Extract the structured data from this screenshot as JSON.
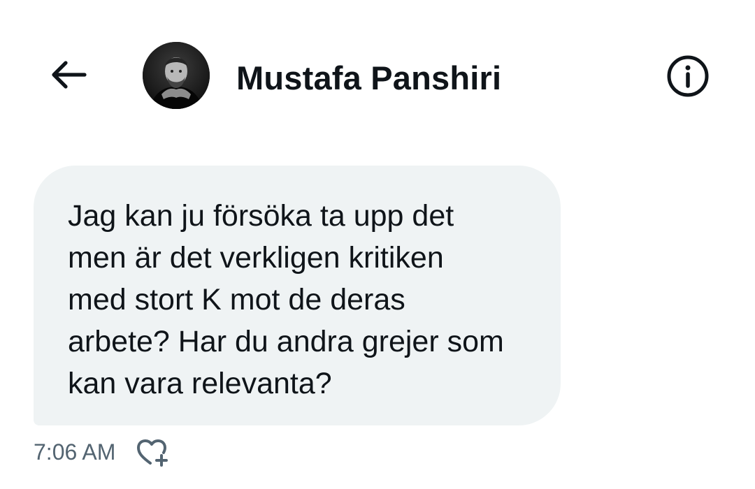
{
  "header": {
    "back_icon": "arrow-left-icon",
    "contact_name": "Mustafa Panshiri",
    "info_icon": "info-icon"
  },
  "conversation": {
    "messages": [
      {
        "text": "Jag kan ju försöka ta upp det\nmen är det verkligen kritiken\nmed stort K mot de deras\narbete? Har du andra grejer som\nkan vara relevanta?",
        "time": "7:06 AM",
        "reaction_icon": "heart-plus-icon"
      }
    ]
  },
  "colors": {
    "text_primary": "#0f1419",
    "text_secondary": "#536471",
    "bubble_background": "#eff3f4",
    "background": "#ffffff"
  }
}
